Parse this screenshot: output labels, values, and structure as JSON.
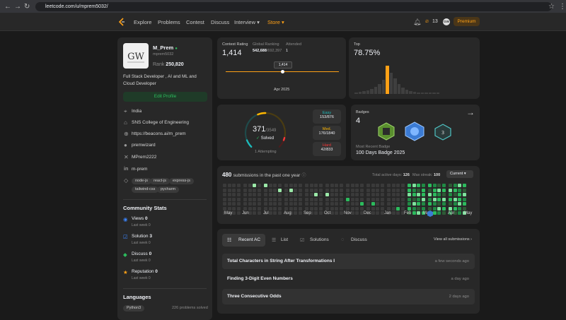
{
  "browser": {
    "url": "leetcode.com/u/mprem5032/"
  },
  "nav": {
    "links": [
      "Explore",
      "Problems",
      "Contest",
      "Discuss",
      "Interview",
      "Store"
    ],
    "streak": "13",
    "avatar_initials": "GW",
    "premium": "Premium",
    "colors": {
      "store": "#ffa116",
      "premium": "#ffa116"
    }
  },
  "profile": {
    "name": "M_Prem",
    "username": "mprem5032",
    "rank_label": "Rank",
    "rank": "250,820",
    "bio": "Full Stack Developer , AI and ML and Cloud Developer",
    "edit_button": "Edit Profile",
    "location": "India",
    "college": "SNS College of Engineering",
    "website": "https://beacons.ai/m_prem",
    "github": "premwizard",
    "twitter": "MPrem2222",
    "linkedin": "m-prem",
    "skills": [
      "node-js",
      "react-js",
      "express-js",
      "tailwind-css",
      "pycharm"
    ]
  },
  "community": {
    "title": "Community Stats",
    "items": [
      {
        "label": "Views",
        "value": "0",
        "sub": "Last week 0",
        "icon": "eye-icon",
        "color": "#3b82f6"
      },
      {
        "label": "Solution",
        "value": "3",
        "sub": "Last week 0",
        "icon": "check-square-icon",
        "color": "#3b82f6"
      },
      {
        "label": "Discuss",
        "value": "0",
        "sub": "Last week 0",
        "icon": "chat-icon",
        "color": "#2cbb5d"
      },
      {
        "label": "Reputation",
        "value": "0",
        "sub": "Last week 0",
        "icon": "star-icon",
        "color": "#ffa116"
      }
    ]
  },
  "languages": {
    "title": "Languages",
    "first_lang": "Python3",
    "first_count": "226 problems solved"
  },
  "contest": {
    "rating_label": "Contest Rating",
    "rating": "1,414",
    "global_label": "Global Ranking",
    "global_rank": "542,688",
    "global_total": "/692,397",
    "attended_label": "Attended",
    "attended": "1",
    "tooltip": "1,414",
    "date": "Apr 2025",
    "top_label": "Top",
    "top_pct": "78.75%",
    "histogram": [
      2,
      3,
      4,
      5,
      7,
      10,
      14,
      20,
      40,
      30,
      22,
      14,
      9,
      6,
      4,
      3,
      2,
      2,
      1,
      1,
      1,
      1
    ],
    "highlight_index": 8
  },
  "solved": {
    "count": "371",
    "total": "/3549",
    "label": "Solved",
    "attempting": "1 Attempting",
    "easy_label": "Easy",
    "easy": "153/876",
    "med_label": "Med.",
    "med": "176/1840",
    "hard_label": "Hard",
    "hard": "42/833",
    "colors": {
      "easy": "#1cbaba",
      "med": "#ffb700",
      "hard": "#f63737"
    },
    "fractions": {
      "easy": 0.41,
      "med": 0.47,
      "hard": 0.12,
      "total": 0.1
    }
  },
  "badges": {
    "label": "Badges",
    "count": "4",
    "recent_label": "Most Recent Badge",
    "recent": "100 Days Badge 2025",
    "list": [
      "badge-1-icon",
      "badge-2-icon",
      "badge-3-icon"
    ]
  },
  "heatmap": {
    "count": "480",
    "text": "submissions in the past one year",
    "active_label": "Total active days:",
    "active": "126",
    "streak_label": "Max streak:",
    "streak": "100",
    "select": "Current",
    "months": [
      "May",
      "Jun",
      "Jul",
      "Aug",
      "Sep",
      "Oct",
      "Nov",
      "Dec",
      "Jan",
      "Feb",
      "Mar",
      "Apr",
      "May"
    ]
  },
  "tabs": {
    "items": [
      "Recent AC",
      "List",
      "Solutions",
      "Discuss"
    ],
    "view_all": "View all submissions"
  },
  "submissions": [
    {
      "title": "Total Characters in String After Transformations I",
      "time": "a few seconds ago"
    },
    {
      "title": "Finding 3-Digit Even Numbers",
      "time": "a day ago"
    },
    {
      "title": "Three Consecutive Odds",
      "time": "2 days ago"
    }
  ]
}
